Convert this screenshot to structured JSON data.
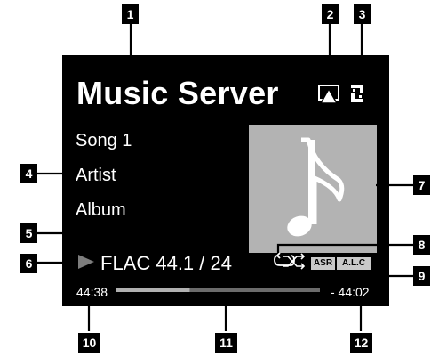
{
  "screen": {
    "source_title": "Music Server",
    "song": "Song 1",
    "artist": "Artist",
    "album": "Album",
    "format": "FLAC 44.1 / 24",
    "elapsed": "44:38",
    "remaining": "- 44:02",
    "progress": 0.36,
    "indicators": {
      "asr": "ASR",
      "alc": "A.L.C"
    },
    "icons": [
      "airplay-icon",
      "connection-icon",
      "play-icon",
      "repeat-icon",
      "shuffle-icon",
      "music-note-icon"
    ]
  },
  "callouts": [
    "1",
    "2",
    "3",
    "4",
    "5",
    "6",
    "7",
    "8",
    "9",
    "10",
    "11",
    "12"
  ],
  "colors": {
    "screen": "#000000",
    "text": "#ffffff",
    "album_art": "#b3b3b3",
    "progress_track": "#6b6b6b",
    "progress_fill": "#b0b0b0",
    "badge": "#c9c9c9"
  }
}
